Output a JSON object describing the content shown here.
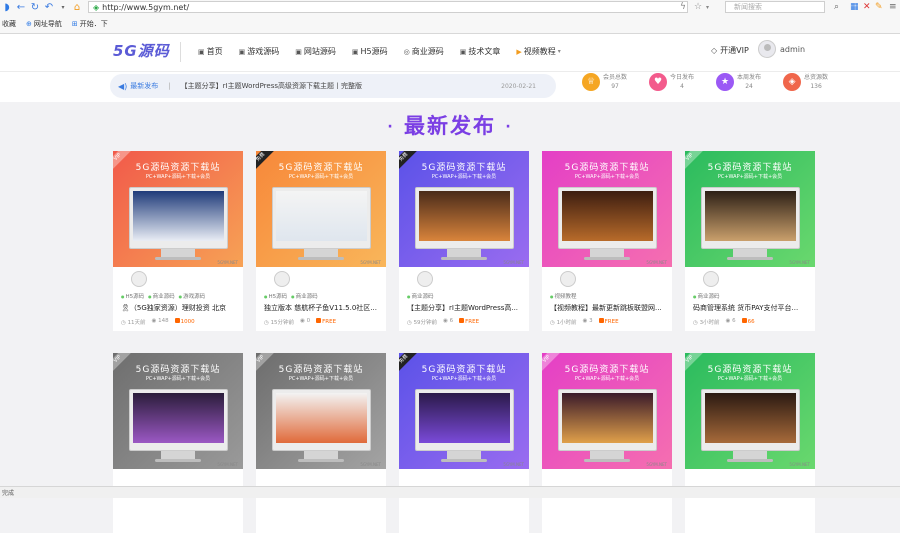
{
  "browser": {
    "url": "http://www.5gym.net/",
    "search_placeholder": "新闻搜索",
    "bookmarks": [
      "收藏",
      "网址导航",
      "开始．下"
    ]
  },
  "header": {
    "logo": "5G源码",
    "menu": [
      {
        "label": "首页",
        "icon": "home-icon"
      },
      {
        "label": "游戏源码",
        "icon": "game-icon"
      },
      {
        "label": "网站源码",
        "icon": "site-icon"
      },
      {
        "label": "H5源码",
        "icon": "h5-icon"
      },
      {
        "label": "商业源码",
        "icon": "biz-icon"
      },
      {
        "label": "技术文章",
        "icon": "article-icon"
      },
      {
        "label": "视频教程",
        "icon": "video-icon"
      }
    ],
    "vip_label": "开通VIP",
    "username": "admin"
  },
  "announcement": {
    "label": "最新发布",
    "text": "【主题分享】rI主题WordPress高级资源下载主题丨完整版",
    "date": "2020-02-21"
  },
  "stats": [
    {
      "label": "会员总数",
      "value": "97",
      "color": "#f5a623"
    },
    {
      "label": "今日发布",
      "value": "4",
      "color": "#f35b8c"
    },
    {
      "label": "本周发布",
      "value": "24",
      "color": "#9b59f5"
    },
    {
      "label": "总资源数",
      "value": "136",
      "color": "#f0664b"
    }
  ],
  "section_title": "最新发布",
  "card_template": {
    "banner_title": "5G源码资源下载站",
    "banner_sub": "PC+WAP+源码+下载+会员",
    "watermark": "5GYM.NET"
  },
  "cards": [
    {
      "ribbon": "VIP",
      "ribbon_type": "vip",
      "tags": [
        "H5源码",
        "商业源码",
        "游戏源码"
      ],
      "title": "🎗（5G独家资源）理财投资 北京",
      "time": "11天前",
      "views": "148",
      "price": "1000",
      "grad": [
        "#f15a4a",
        "#f7a255"
      ]
    },
    {
      "ribbon": "免费",
      "ribbon_type": "free",
      "tags": [
        "H5源码",
        "商业源码"
      ],
      "title": "独立版本 慈航杯子鱼V11.5.0社区...",
      "time": "15分钟前",
      "views": "0",
      "price": "FREE",
      "grad": [
        "#f7883a",
        "#f9b65a"
      ]
    },
    {
      "ribbon": "免费",
      "ribbon_type": "free",
      "tags": [
        "商业源码"
      ],
      "title": "【主题分享】rI主题WordPress高...",
      "time": "59分钟前",
      "views": "6",
      "price": "FREE",
      "grad": [
        "#5b52e8",
        "#9a6cf0"
      ]
    },
    {
      "ribbon": "",
      "ribbon_type": "none",
      "tags": [
        "视频教程"
      ],
      "title": "【视频教程】最新更新跳板联盟网...",
      "time": "1小时前",
      "views": "3",
      "price": "FREE",
      "grad": [
        "#e43fc6",
        "#f56fb0"
      ]
    },
    {
      "ribbon": "VIP",
      "ribbon_type": "vip",
      "tags": [
        "商业源码"
      ],
      "title": "码商管理系统 货币PAY支付平台...",
      "time": "3小时前",
      "views": "6",
      "price": "66",
      "grad": [
        "#2bbb5e",
        "#6ad86e"
      ]
    },
    {
      "ribbon": "VIP",
      "ribbon_type": "vip",
      "tags": [],
      "title": "",
      "time": "",
      "views": "",
      "price": "",
      "grad": [
        "#6e6e6e",
        "#9a9a9a"
      ]
    },
    {
      "ribbon": "VIP",
      "ribbon_type": "vip",
      "tags": [],
      "title": "",
      "time": "",
      "views": "",
      "price": "",
      "grad": [
        "#6d6d6d",
        "#a4a4a4"
      ]
    },
    {
      "ribbon": "免费",
      "ribbon_type": "free",
      "tags": [],
      "title": "",
      "time": "",
      "views": "",
      "price": "",
      "grad": [
        "#5b52e8",
        "#9a6cf0"
      ]
    },
    {
      "ribbon": "VIP",
      "ribbon_type": "vip",
      "tags": [],
      "title": "",
      "time": "",
      "views": "",
      "price": "",
      "grad": [
        "#e43fc6",
        "#f56fb0"
      ]
    },
    {
      "ribbon": "VIP",
      "ribbon_type": "vip",
      "tags": [],
      "title": "",
      "time": "",
      "views": "",
      "price": "",
      "grad": [
        "#2bbb5e",
        "#6ad86e"
      ]
    }
  ],
  "statusbar": "完成"
}
